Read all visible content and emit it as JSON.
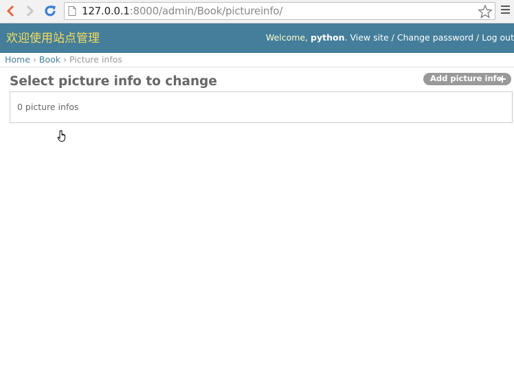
{
  "browser": {
    "url_host": "127.0.0.1",
    "url_rest": ":8000/admin/Book/pictureinfo/",
    "icons": {
      "back": "chevron-left-icon",
      "forward": "chevron-right-icon",
      "reload": "reload-icon",
      "page": "page-icon",
      "bookmark": "star-icon",
      "menu": "hamburger-menu-icon"
    },
    "colors": {
      "back_arrow": "#e8663c",
      "reload": "#3b7fd1"
    }
  },
  "header": {
    "site_title": "欢迎使用站点管理",
    "welcome_text": "Welcome, ",
    "username": "python",
    "view_site": "View site",
    "change_password": "Change password",
    "log_out": "Log out",
    "separator": " / ",
    "colors": {
      "background": "#447e9b",
      "title": "#f5dd5d"
    }
  },
  "breadcrumbs": {
    "home": "Home",
    "app": "Book",
    "current": "Picture infos",
    "separator": "›"
  },
  "content": {
    "title": "Select picture info to change",
    "add_button": "Add picture info",
    "paginator": "0 picture infos"
  }
}
